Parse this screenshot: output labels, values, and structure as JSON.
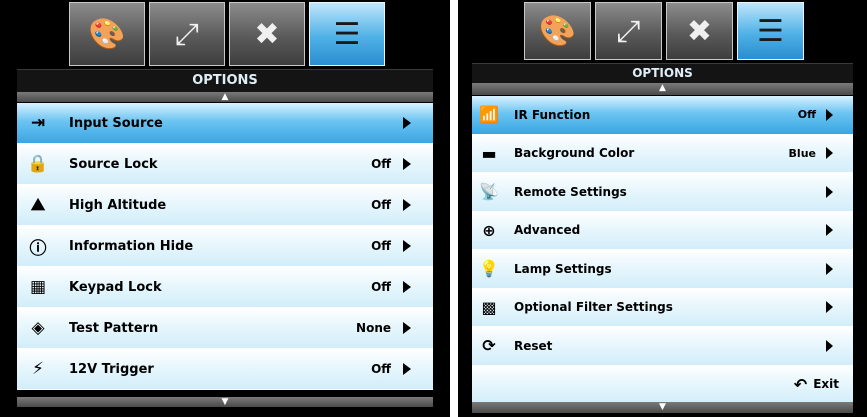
{
  "left": {
    "tabs": [
      {
        "icon": "palette-icon",
        "glyph": "🎨"
      },
      {
        "icon": "screen-resize-icon",
        "glyph": "⤢"
      },
      {
        "icon": "tools-icon",
        "glyph": "✖"
      },
      {
        "icon": "options-list-icon",
        "glyph": "☰",
        "active": true
      }
    ],
    "title": "OPTIONS",
    "scroll_up": "▲",
    "scroll_down": "▼",
    "items": [
      {
        "icon": "input-source-icon",
        "glyph": "⇥",
        "label": "Input Source",
        "value": "",
        "selected": true
      },
      {
        "icon": "source-lock-icon",
        "glyph": "🔒",
        "label": "Source Lock",
        "value": "Off"
      },
      {
        "icon": "high-altitude-icon",
        "glyph": "⛰",
        "label": "High Altitude",
        "value": "Off"
      },
      {
        "icon": "info-icon",
        "glyph": "ⓘ",
        "label": "Information Hide",
        "value": "Off"
      },
      {
        "icon": "keypad-lock-icon",
        "glyph": "▦",
        "label": "Keypad Lock",
        "value": "Off"
      },
      {
        "icon": "test-pattern-icon",
        "glyph": "◈",
        "label": "Test Pattern",
        "value": "None"
      },
      {
        "icon": "12v-trigger-icon",
        "glyph": "⚡",
        "label": "12V Trigger",
        "value": "Off"
      }
    ]
  },
  "right": {
    "tabs": [
      {
        "icon": "palette-icon",
        "glyph": "🎨"
      },
      {
        "icon": "screen-resize-icon",
        "glyph": "⤢"
      },
      {
        "icon": "tools-icon",
        "glyph": "✖"
      },
      {
        "icon": "options-list-icon",
        "glyph": "☰",
        "active": true
      }
    ],
    "title": "OPTIONS",
    "scroll_up": "▲",
    "scroll_down": "▼",
    "items": [
      {
        "icon": "ir-function-icon",
        "glyph": "📶",
        "label": "IR Function",
        "value": "Off",
        "selected": true
      },
      {
        "icon": "background-color-icon",
        "glyph": "▬",
        "label": "Background Color",
        "value": "Blue"
      },
      {
        "icon": "remote-settings-icon",
        "glyph": "📡",
        "label": "Remote Settings",
        "value": ""
      },
      {
        "icon": "advanced-icon",
        "glyph": "⊕",
        "label": "Advanced",
        "value": ""
      },
      {
        "icon": "lamp-settings-icon",
        "glyph": "💡",
        "label": "Lamp Settings",
        "value": ""
      },
      {
        "icon": "optional-filter-icon",
        "glyph": "▩",
        "label": "Optional Filter Settings",
        "value": ""
      },
      {
        "icon": "reset-icon",
        "glyph": "⟳",
        "label": "Reset",
        "value": ""
      }
    ],
    "exit": {
      "label": "Exit",
      "icon": "back-arrow-icon",
      "glyph": "↶"
    }
  }
}
